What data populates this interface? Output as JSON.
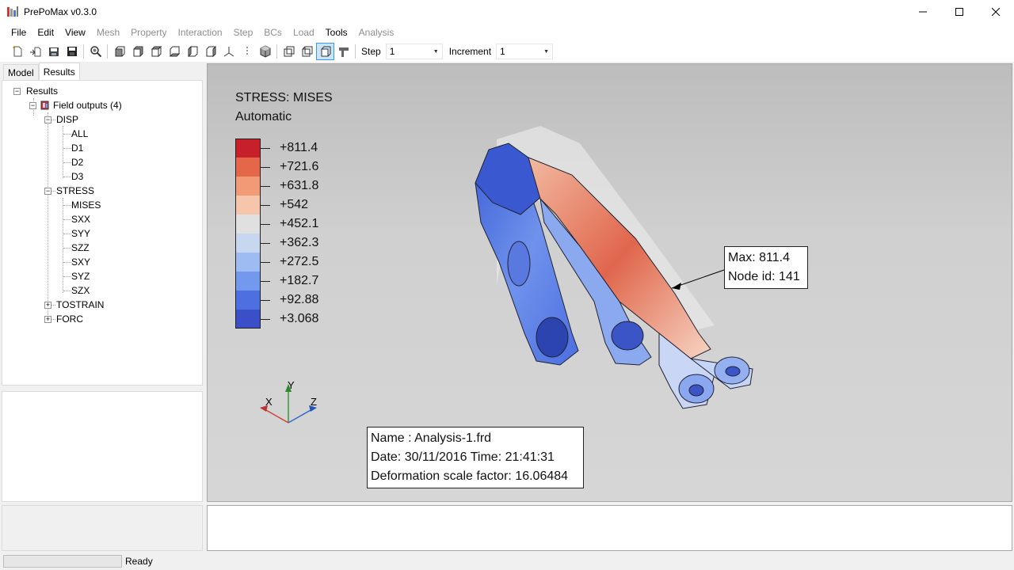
{
  "window": {
    "title": "PrePoMax v0.3.0"
  },
  "menu": [
    {
      "label": "File",
      "enabled": true
    },
    {
      "label": "Edit",
      "enabled": true
    },
    {
      "label": "View",
      "enabled": true
    },
    {
      "label": "Mesh",
      "enabled": false
    },
    {
      "label": "Property",
      "enabled": false
    },
    {
      "label": "Interaction",
      "enabled": false
    },
    {
      "label": "Step",
      "enabled": false
    },
    {
      "label": "BCs",
      "enabled": false
    },
    {
      "label": "Load",
      "enabled": false
    },
    {
      "label": "Tools",
      "enabled": true
    },
    {
      "label": "Analysis",
      "enabled": false
    }
  ],
  "toolbar": {
    "step_label": "Step",
    "step_value": "1",
    "increment_label": "Increment",
    "increment_value": "1"
  },
  "tabs": [
    {
      "label": "Model",
      "active": false
    },
    {
      "label": "Results",
      "active": true
    }
  ],
  "tree": {
    "root": "Results",
    "field_outputs": "Field outputs (4)",
    "disp": {
      "label": "DISP",
      "children": [
        "ALL",
        "D1",
        "D2",
        "D3"
      ]
    },
    "stress": {
      "label": "STRESS",
      "children": [
        "MISES",
        "SXX",
        "SYY",
        "SZZ",
        "SXY",
        "SYZ",
        "SZX"
      ]
    },
    "tostrain": "TOSTRAIN",
    "forc": "FORC"
  },
  "legend": {
    "title": "STRESS: MISES",
    "mode": "Automatic",
    "values": [
      "+811.4",
      "+721.6",
      "+631.8",
      "+542",
      "+452.1",
      "+362.3",
      "+272.5",
      "+182.7",
      "+92.88",
      "+3.068"
    ],
    "colors": [
      "#c8202a",
      "#e4674a",
      "#f19a75",
      "#f5c6ab",
      "#e0e0e0",
      "#c7d7f0",
      "#9ebbf2",
      "#7399ef",
      "#4d6fe0",
      "#3a4fc8"
    ]
  },
  "max_annotation": {
    "line1": "Max: 811.4",
    "line2": "Node id: 141"
  },
  "axes": {
    "x": "X",
    "y": "Y",
    "z": "Z"
  },
  "info": {
    "name": "Name : Analysis-1.frd",
    "date": "Date: 30/11/2016   Time: 21:41:31",
    "scale": "Deformation scale factor: 16.06484"
  },
  "status": {
    "text": "Ready",
    "progress": 0
  }
}
